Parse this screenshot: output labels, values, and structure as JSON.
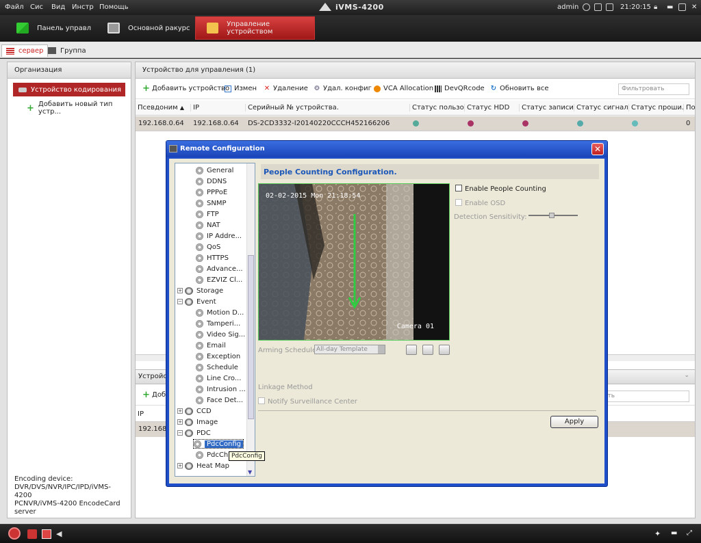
{
  "topbar": {
    "menu": [
      "Файл",
      "Сис",
      "Вид",
      "Инстр",
      "Помощь"
    ],
    "title": "iVMS-4200",
    "user": "admin",
    "time": "21:20:15"
  },
  "tabs": [
    "Панель управл",
    "Основной ракурс",
    "Управление устройством"
  ],
  "subtabs": [
    "сервер",
    "Группа"
  ],
  "left": {
    "header": "Организация",
    "items": [
      "Устройство кодирования",
      "Добавить новый тип устр..."
    ],
    "footer": [
      "Encoding device:",
      "DVR/DVS/NVR/IPC/IPD/iVMS-4200",
      "PCNVR/iVMS-4200 EncodeCard",
      "server"
    ]
  },
  "devices": {
    "header": "Устройство для управления (1)",
    "toolbar": [
      "Добавить устройство",
      "Измен",
      "Удаление",
      "Удал. конфиг",
      "VCA Allocation",
      "DevQRcode",
      "Обновить все"
    ],
    "filter_placeholder": "Фильтровать",
    "columns": [
      "Псевдоним",
      "IP",
      "Серийный № устройства.",
      "Статус пользо...",
      "Статус HDD",
      "Статус записи",
      "Статус сигнала",
      "Статус проши...",
      "По"
    ],
    "row": {
      "alias": "192.168.0.64",
      "ip": "192.168.0.64",
      "serial": "DS-2CD3332-I20140220CCCH452166206",
      "last": "0"
    }
  },
  "lower": {
    "header": "Устройст",
    "add": "Доба",
    "filter": "ать",
    "col_ip": "IP",
    "row_ip": "192.168.0."
  },
  "dialog": {
    "title": "Remote Configuration",
    "tree": [
      {
        "label": "General",
        "type": "leaf"
      },
      {
        "label": "DDNS",
        "type": "leaf"
      },
      {
        "label": "PPPoE",
        "type": "leaf"
      },
      {
        "label": "SNMP",
        "type": "leaf"
      },
      {
        "label": "FTP",
        "type": "leaf"
      },
      {
        "label": "NAT",
        "type": "leaf"
      },
      {
        "label": "IP Addre...",
        "type": "leaf"
      },
      {
        "label": "QoS",
        "type": "leaf"
      },
      {
        "label": "HTTPS",
        "type": "leaf"
      },
      {
        "label": "Advance...",
        "type": "leaf"
      },
      {
        "label": "EZVIZ Cl...",
        "type": "leaf"
      },
      {
        "label": "Storage",
        "type": "group",
        "sign": "+"
      },
      {
        "label": "Event",
        "type": "group",
        "sign": "−"
      },
      {
        "label": "Motion D...",
        "type": "leaf"
      },
      {
        "label": "Tamperi...",
        "type": "leaf"
      },
      {
        "label": "Video Sig...",
        "type": "leaf"
      },
      {
        "label": "Email",
        "type": "leaf"
      },
      {
        "label": "Exception",
        "type": "leaf"
      },
      {
        "label": "Schedule",
        "type": "leaf"
      },
      {
        "label": "Line Cro...",
        "type": "leaf"
      },
      {
        "label": "Intrusion ...",
        "type": "leaf"
      },
      {
        "label": "Face Det...",
        "type": "leaf"
      },
      {
        "label": "CCD",
        "type": "group",
        "sign": "+"
      },
      {
        "label": "Image",
        "type": "group",
        "sign": "+"
      },
      {
        "label": "PDC",
        "type": "group",
        "sign": "−"
      },
      {
        "label": "PdcConfig",
        "type": "leaf",
        "selected": true
      },
      {
        "label": "PdcCh",
        "type": "leaf"
      },
      {
        "label": "Heat Map",
        "type": "group",
        "sign": "+"
      }
    ],
    "tooltip": "PdcConfig",
    "section_title": "People Counting Configuration.",
    "video_timestamp": "02-02-2015 Mon 21:18:54",
    "video_camera": "Camera 01",
    "enable_counting": "Enable People Counting",
    "enable_osd": "Enable OSD",
    "sensitivity": "Detection Sensitivity:",
    "arming_label": "Arming Schedule:",
    "arming_value": "All-day Template",
    "linkage": "Linkage Method",
    "notify": "Notify Surveillance Center",
    "apply": "Apply"
  }
}
